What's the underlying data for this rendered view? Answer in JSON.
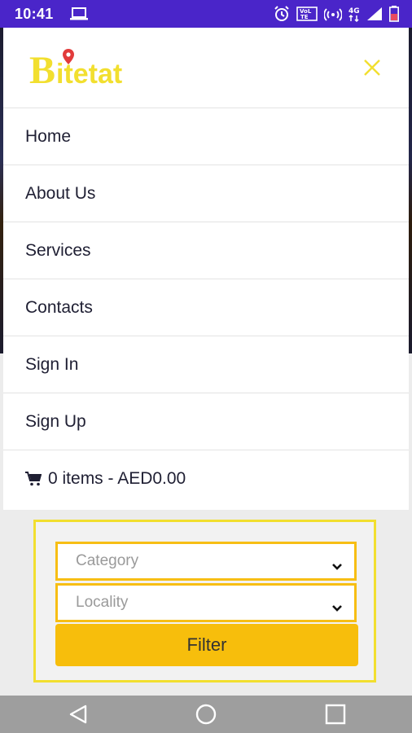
{
  "status_bar": {
    "time": "10:41",
    "icons": [
      "laptop-icon",
      "alarm-icon",
      "volte-icon",
      "hotspot-icon",
      "4g-signal-icon",
      "battery-icon"
    ]
  },
  "brand": {
    "logo_text": "Bitetat",
    "logo_color": "#f2df2f",
    "pin_color": "#e23b3b"
  },
  "menu": {
    "items": [
      {
        "label": "Home"
      },
      {
        "label": "About Us"
      },
      {
        "label": "Services"
      },
      {
        "label": "Contacts"
      },
      {
        "label": "Sign In"
      },
      {
        "label": "Sign Up"
      }
    ],
    "cart_label": "0 items - AED0.00"
  },
  "filter": {
    "category_placeholder": "Category",
    "locality_placeholder": "Locality",
    "button_label": "Filter",
    "accent": "#f7be0c",
    "border": "#f2df2f"
  },
  "colors": {
    "status_bar": "#4a25c9",
    "nav_bar": "#9e9e9e"
  }
}
